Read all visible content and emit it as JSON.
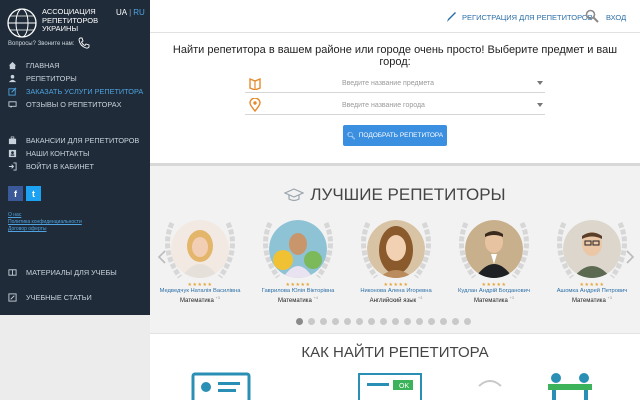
{
  "sidebar": {
    "brand": [
      "АССОЦИАЦИЯ",
      "РЕПЕТИТОРОВ",
      "УКРАИНЫ"
    ],
    "lang_active": "UA",
    "lang_other": "RU",
    "call_us": "Вопросы? Звоните нам:",
    "nav_main": [
      {
        "label": "ГЛАВНАЯ",
        "icon": "home-icon"
      },
      {
        "label": "РЕПЕТИТОРЫ",
        "icon": "users-icon"
      },
      {
        "label": "ЗАКАЗАТЬ УСЛУГИ РЕПЕТИТОРА",
        "icon": "edit-icon",
        "active": true
      },
      {
        "label": "ОТЗЫВЫ О РЕПЕТИТОРАХ",
        "icon": "comment-icon"
      }
    ],
    "nav_secondary": [
      {
        "label": "ВАКАНСИИ ДЛЯ РЕПЕТИТОРОВ",
        "icon": "briefcase-icon"
      },
      {
        "label": "НАШИ КОНТАКТЫ",
        "icon": "contacts-icon"
      },
      {
        "label": "ВОЙТИ В КАБИНЕТ",
        "icon": "login-icon"
      }
    ],
    "social": {
      "facebook": "f",
      "twitter": "t"
    },
    "small_links": [
      "О нас",
      "Политика конфиденциальности",
      "Договор оферты"
    ],
    "nav_bottom": [
      {
        "label": "МАТЕРИАЛЫ ДЛЯ УЧЕБЫ",
        "icon": "book-icon"
      },
      {
        "label": "УЧЕБНЫЕ СТАТЬИ",
        "icon": "pencil-icon"
      }
    ]
  },
  "header": {
    "register": "РЕГИСТРАЦИЯ ДЛЯ РЕПЕТИТОРОВ",
    "login": "ВХОД"
  },
  "search": {
    "title": "Найти репетитора в вашем районе или городе очень просто! Выберите предмет и ваш город:",
    "subject_placeholder": "Введите название предмета",
    "city_placeholder": "Введите название города",
    "button": "ПОДОБРАТЬ РЕПЕТИТОРА"
  },
  "best": {
    "title": "ЛУЧШИЕ РЕПЕТИТОРЫ",
    "tutors": [
      {
        "name": "Медведчук Наталія Василівна",
        "subject": "Математика",
        "more": "+3",
        "stars": "★★★★★"
      },
      {
        "name": "Гаврилова Юлія Вікторівна",
        "subject": "Математика",
        "more": "+4",
        "stars": "★★★★★"
      },
      {
        "name": "Никонова Алена Игоревна",
        "subject": "Английский язык",
        "more": "+3",
        "stars": "★★★★★"
      },
      {
        "name": "Кудлан Андрій Богданович",
        "subject": "Математика",
        "more": "+3",
        "stars": "★★★★★"
      },
      {
        "name": "Ашомка Андрей Петрович",
        "subject": "Математика",
        "more": "+3",
        "stars": "★★★★★"
      }
    ],
    "dots_total": 15,
    "dots_active": 1
  },
  "how": {
    "title": "КАК НАЙТИ РЕПЕТИТОРА",
    "ok_label": "OK"
  },
  "colors": {
    "accent": "#3b8fe0",
    "sidebar": "#1f2b38",
    "link": "#2c6fa8",
    "orange": "#e58a2c"
  }
}
